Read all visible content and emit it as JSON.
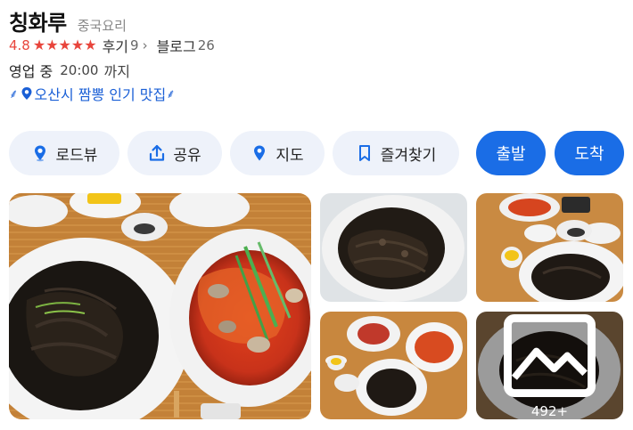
{
  "place": {
    "name": "칭화루",
    "category": "중국요리"
  },
  "rating": {
    "score": "4.8",
    "stars": 5,
    "review_label": "후기",
    "review_count": "9",
    "review_chevron": "›",
    "blog_label": "블로그",
    "blog_count": "26"
  },
  "hours": {
    "status": "영업 중",
    "time": "20:00",
    "until": "까지"
  },
  "award": {
    "text": "오산시 짬뽕 인기 맛집",
    "laurel_left": "⸙",
    "laurel_right": "⸙",
    "icon": "pin-icon"
  },
  "actions": [
    {
      "label": "로드뷰",
      "icon": "roadview-pin-icon"
    },
    {
      "label": "공유",
      "icon": "share-icon"
    },
    {
      "label": "지도",
      "icon": "map-pin-icon"
    },
    {
      "label": "즐겨찾기",
      "icon": "bookmark-icon"
    }
  ],
  "primary_actions": {
    "depart": "출발",
    "arrive": "도착"
  },
  "photos": {
    "more_count": "492+",
    "more_icon": "gallery-icon"
  },
  "colors": {
    "accent": "#1a6de6",
    "star": "#e8453c",
    "chip_bg": "#eef2fa",
    "award": "#1a5fd6"
  }
}
